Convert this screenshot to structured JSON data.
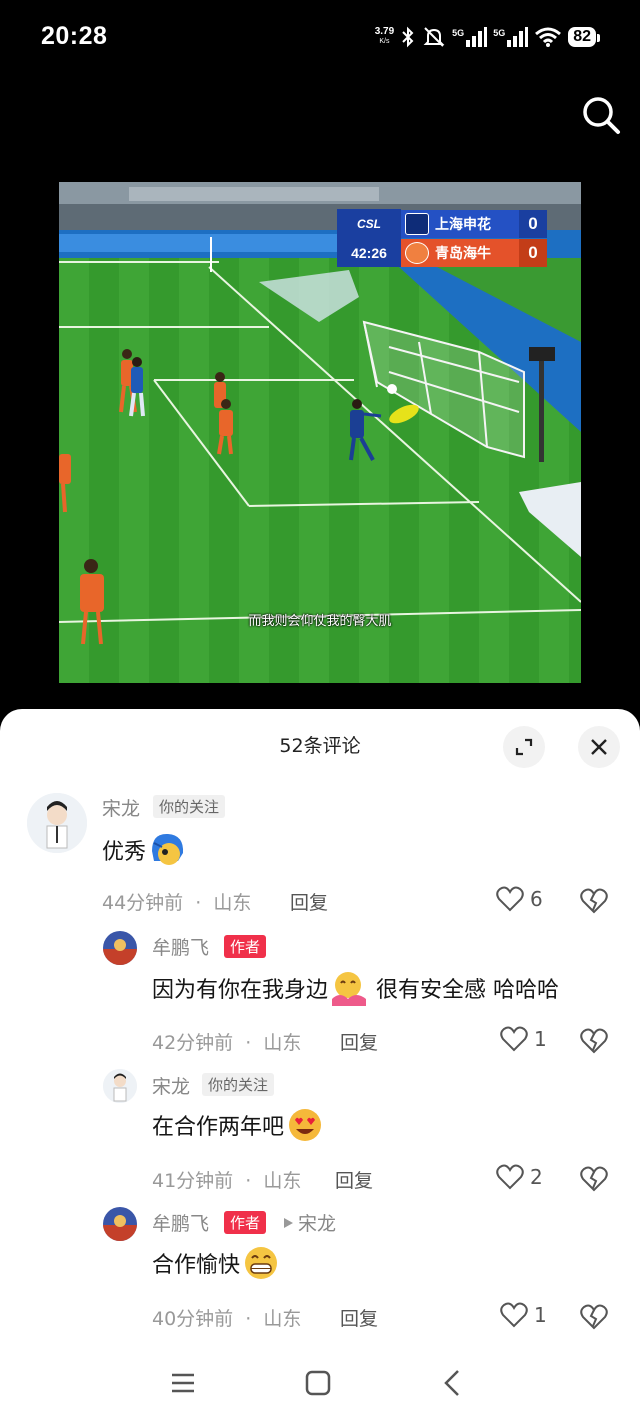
{
  "status_bar": {
    "time": "20:28",
    "net_speed": "3.79",
    "net_unit": "K/s",
    "sim1_label": "5G",
    "sim2_label": "5G",
    "battery": "82",
    "icons": [
      "bluetooth-icon",
      "mute-icon",
      "signal-icon",
      "signal-icon",
      "wifi-icon",
      "battery-icon"
    ]
  },
  "video": {
    "subtitle": "而我则会仰仗我的臀大肌",
    "scoreboard": {
      "league": "CSL",
      "clock": "42:26",
      "team1": "上海申花",
      "score1": "0",
      "team2": "青岛海牛",
      "score2": "0"
    }
  },
  "comments_panel": {
    "title": "52条评论",
    "expand_icon": "expand-icon",
    "close_icon": "close-icon",
    "comments": [
      {
        "user": "宋龙",
        "tag": "你的关注",
        "text": "优秀",
        "emoji": "crying-face-emoji",
        "time": "44分钟前",
        "location": "山东",
        "reply_label": "回复",
        "likes": "6"
      },
      {
        "user": "牟鹏飞",
        "tag": "作者",
        "text": "因为有你在我身边",
        "emoji": "hug-emoji",
        "text_after": "很有安全感 哈哈哈",
        "time": "42分钟前",
        "location": "山东",
        "reply_label": "回复",
        "likes": "1"
      },
      {
        "user": "宋龙",
        "tag": "你的关注",
        "text": "在合作两年吧",
        "emoji": "heart-eyes-emoji",
        "time": "41分钟前",
        "location": "山东",
        "reply_label": "回复",
        "likes": "2"
      },
      {
        "user": "牟鹏飞",
        "tag": "作者",
        "reply_to": "宋龙",
        "text": "合作愉快",
        "emoji": "grin-emoji",
        "time": "40分钟前",
        "location": "山东",
        "reply_label": "回复",
        "likes": "1"
      }
    ],
    "separator": "·"
  },
  "nav_bar": {
    "icons": [
      "menu-icon",
      "home-icon",
      "back-icon"
    ]
  },
  "colors": {
    "author_tag": "#f0304a",
    "pitch": "#3a9a32",
    "home_team": "#2451c4",
    "away_team": "#e4522a"
  }
}
